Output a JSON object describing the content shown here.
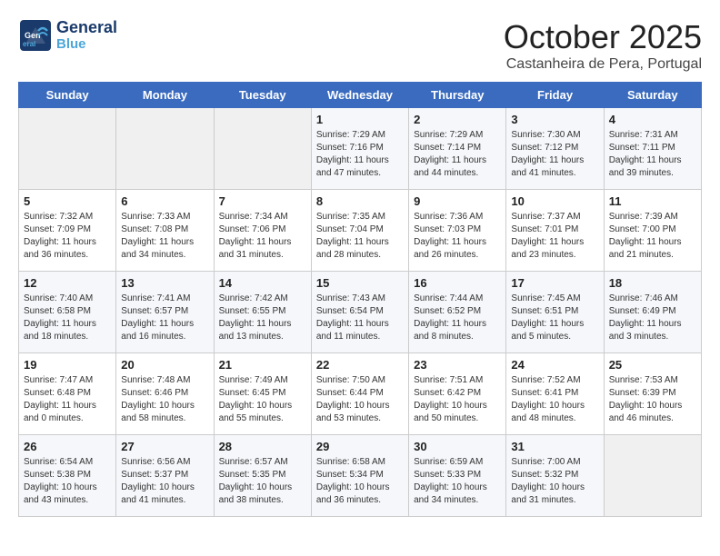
{
  "header": {
    "logo_general": "General",
    "logo_blue": "Blue",
    "month_title": "October 2025",
    "subtitle": "Castanheira de Pera, Portugal"
  },
  "weekdays": [
    "Sunday",
    "Monday",
    "Tuesday",
    "Wednesday",
    "Thursday",
    "Friday",
    "Saturday"
  ],
  "weeks": [
    [
      {
        "day": "",
        "info": ""
      },
      {
        "day": "",
        "info": ""
      },
      {
        "day": "",
        "info": ""
      },
      {
        "day": "1",
        "info": "Sunrise: 7:29 AM\nSunset: 7:16 PM\nDaylight: 11 hours\nand 47 minutes."
      },
      {
        "day": "2",
        "info": "Sunrise: 7:29 AM\nSunset: 7:14 PM\nDaylight: 11 hours\nand 44 minutes."
      },
      {
        "day": "3",
        "info": "Sunrise: 7:30 AM\nSunset: 7:12 PM\nDaylight: 11 hours\nand 41 minutes."
      },
      {
        "day": "4",
        "info": "Sunrise: 7:31 AM\nSunset: 7:11 PM\nDaylight: 11 hours\nand 39 minutes."
      }
    ],
    [
      {
        "day": "5",
        "info": "Sunrise: 7:32 AM\nSunset: 7:09 PM\nDaylight: 11 hours\nand 36 minutes."
      },
      {
        "day": "6",
        "info": "Sunrise: 7:33 AM\nSunset: 7:08 PM\nDaylight: 11 hours\nand 34 minutes."
      },
      {
        "day": "7",
        "info": "Sunrise: 7:34 AM\nSunset: 7:06 PM\nDaylight: 11 hours\nand 31 minutes."
      },
      {
        "day": "8",
        "info": "Sunrise: 7:35 AM\nSunset: 7:04 PM\nDaylight: 11 hours\nand 28 minutes."
      },
      {
        "day": "9",
        "info": "Sunrise: 7:36 AM\nSunset: 7:03 PM\nDaylight: 11 hours\nand 26 minutes."
      },
      {
        "day": "10",
        "info": "Sunrise: 7:37 AM\nSunset: 7:01 PM\nDaylight: 11 hours\nand 23 minutes."
      },
      {
        "day": "11",
        "info": "Sunrise: 7:39 AM\nSunset: 7:00 PM\nDaylight: 11 hours\nand 21 minutes."
      }
    ],
    [
      {
        "day": "12",
        "info": "Sunrise: 7:40 AM\nSunset: 6:58 PM\nDaylight: 11 hours\nand 18 minutes."
      },
      {
        "day": "13",
        "info": "Sunrise: 7:41 AM\nSunset: 6:57 PM\nDaylight: 11 hours\nand 16 minutes."
      },
      {
        "day": "14",
        "info": "Sunrise: 7:42 AM\nSunset: 6:55 PM\nDaylight: 11 hours\nand 13 minutes."
      },
      {
        "day": "15",
        "info": "Sunrise: 7:43 AM\nSunset: 6:54 PM\nDaylight: 11 hours\nand 11 minutes."
      },
      {
        "day": "16",
        "info": "Sunrise: 7:44 AM\nSunset: 6:52 PM\nDaylight: 11 hours\nand 8 minutes."
      },
      {
        "day": "17",
        "info": "Sunrise: 7:45 AM\nSunset: 6:51 PM\nDaylight: 11 hours\nand 5 minutes."
      },
      {
        "day": "18",
        "info": "Sunrise: 7:46 AM\nSunset: 6:49 PM\nDaylight: 11 hours\nand 3 minutes."
      }
    ],
    [
      {
        "day": "19",
        "info": "Sunrise: 7:47 AM\nSunset: 6:48 PM\nDaylight: 11 hours\nand 0 minutes."
      },
      {
        "day": "20",
        "info": "Sunrise: 7:48 AM\nSunset: 6:46 PM\nDaylight: 10 hours\nand 58 minutes."
      },
      {
        "day": "21",
        "info": "Sunrise: 7:49 AM\nSunset: 6:45 PM\nDaylight: 10 hours\nand 55 minutes."
      },
      {
        "day": "22",
        "info": "Sunrise: 7:50 AM\nSunset: 6:44 PM\nDaylight: 10 hours\nand 53 minutes."
      },
      {
        "day": "23",
        "info": "Sunrise: 7:51 AM\nSunset: 6:42 PM\nDaylight: 10 hours\nand 50 minutes."
      },
      {
        "day": "24",
        "info": "Sunrise: 7:52 AM\nSunset: 6:41 PM\nDaylight: 10 hours\nand 48 minutes."
      },
      {
        "day": "25",
        "info": "Sunrise: 7:53 AM\nSunset: 6:39 PM\nDaylight: 10 hours\nand 46 minutes."
      }
    ],
    [
      {
        "day": "26",
        "info": "Sunrise: 6:54 AM\nSunset: 5:38 PM\nDaylight: 10 hours\nand 43 minutes."
      },
      {
        "day": "27",
        "info": "Sunrise: 6:56 AM\nSunset: 5:37 PM\nDaylight: 10 hours\nand 41 minutes."
      },
      {
        "day": "28",
        "info": "Sunrise: 6:57 AM\nSunset: 5:35 PM\nDaylight: 10 hours\nand 38 minutes."
      },
      {
        "day": "29",
        "info": "Sunrise: 6:58 AM\nSunset: 5:34 PM\nDaylight: 10 hours\nand 36 minutes."
      },
      {
        "day": "30",
        "info": "Sunrise: 6:59 AM\nSunset: 5:33 PM\nDaylight: 10 hours\nand 34 minutes."
      },
      {
        "day": "31",
        "info": "Sunrise: 7:00 AM\nSunset: 5:32 PM\nDaylight: 10 hours\nand 31 minutes."
      },
      {
        "day": "",
        "info": ""
      }
    ]
  ]
}
